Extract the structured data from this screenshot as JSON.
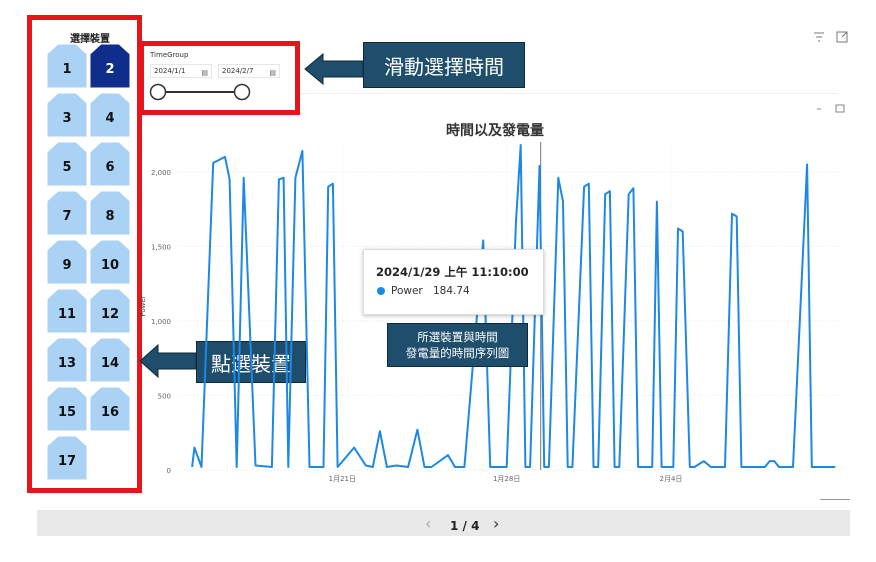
{
  "slicer": {
    "title": "選擇裝置",
    "devices": [
      "1",
      "2",
      "3",
      "4",
      "5",
      "6",
      "7",
      "8",
      "9",
      "10",
      "11",
      "12",
      "13",
      "14",
      "15",
      "16",
      "17"
    ],
    "selected": "2"
  },
  "timegroup": {
    "label": "TimeGroup",
    "start_date": "2024/1/1",
    "end_date": "2024/2/7"
  },
  "callouts": {
    "slide_time": "滑動選擇時間",
    "click_device": "點選裝置",
    "chart_desc_line1": "所選裝置與時間",
    "chart_desc_line2": "發電量的時間序列圖"
  },
  "tooltip": {
    "title": "2024/1/29 上午 11:10:00",
    "series": "Power",
    "value": "184.74"
  },
  "pager": {
    "text": "1 / 4",
    "prev": "‹",
    "next": "›"
  },
  "colors": {
    "highlight_red": "#e8141b",
    "callout_bg": "#1e4e6b",
    "button_fill": "#a9d2f5",
    "button_selected": "#0f2e8c",
    "line": "#1e88e5"
  },
  "chart_data": {
    "type": "line",
    "title": "時間以及發電量",
    "ylabel": "Power",
    "xlabel": "",
    "ylim": [
      0,
      2200
    ],
    "yticks": [
      0,
      500,
      1000,
      1500,
      2000
    ],
    "ytick_labels": [
      "0",
      "500",
      "1,000",
      "1,500",
      "2,000"
    ],
    "xticks": [
      "1月21日",
      "1月28日",
      "2月4日"
    ],
    "grid": true,
    "series": [
      {
        "name": "Power",
        "x": [
          14.6,
          14.7,
          15.0,
          15.5,
          16.0,
          16.2,
          16.5,
          16.8,
          17.3,
          18.0,
          18.3,
          18.5,
          18.7,
          19.0,
          19.3,
          19.6,
          19.8,
          20.2,
          20.4,
          20.6,
          20.8,
          21.5,
          22.0,
          22.3,
          22.6,
          22.9,
          23.3,
          23.8,
          24.2,
          24.5,
          24.8,
          25.5,
          25.8,
          26.0,
          26.2,
          27.0,
          27.3,
          27.6,
          28.0,
          28.4,
          28.6,
          28.8,
          29.0,
          29.4,
          29.6,
          29.8,
          30.2,
          30.4,
          30.6,
          30.8,
          31.3,
          31.5,
          31.7,
          31.9,
          32.2,
          32.4,
          32.6,
          32.8,
          33.2,
          33.4,
          33.6,
          33.8,
          34.0,
          34.2,
          34.4,
          34.6,
          34.9,
          35.1,
          35.3,
          35.5,
          35.8,
          36.0,
          36.2,
          36.4,
          36.7,
          36.9,
          37.1,
          37.3,
          37.6,
          37.8,
          38.0,
          38.2,
          38.8,
          39.0,
          39.2,
          39.4,
          39.6,
          39.8,
          40.0,
          40.2,
          40.8,
          41.0,
          41.2,
          41.4,
          41.6,
          41.8,
          42.0
        ],
        "values": [
          20,
          150,
          20,
          2060,
          2100,
          1950,
          20,
          1960,
          30,
          20,
          1950,
          1960,
          20,
          1960,
          2140,
          20,
          20,
          20,
          1900,
          1920,
          20,
          150,
          30,
          20,
          260,
          20,
          30,
          20,
          270,
          20,
          20,
          100,
          20,
          20,
          20,
          1540,
          20,
          20,
          20,
          1670,
          2180,
          20,
          20,
          2040,
          20,
          20,
          1960,
          1800,
          20,
          20,
          1900,
          1920,
          20,
          20,
          1850,
          1870,
          20,
          20,
          1850,
          1890,
          20,
          20,
          20,
          20,
          1800,
          20,
          20,
          20,
          1620,
          1600,
          20,
          20,
          40,
          60,
          20,
          20,
          20,
          20,
          1720,
          1700,
          20,
          20,
          20,
          20,
          60,
          60,
          20,
          20,
          20,
          20,
          2050,
          20,
          20,
          20,
          20,
          20,
          20
        ]
      }
    ]
  }
}
